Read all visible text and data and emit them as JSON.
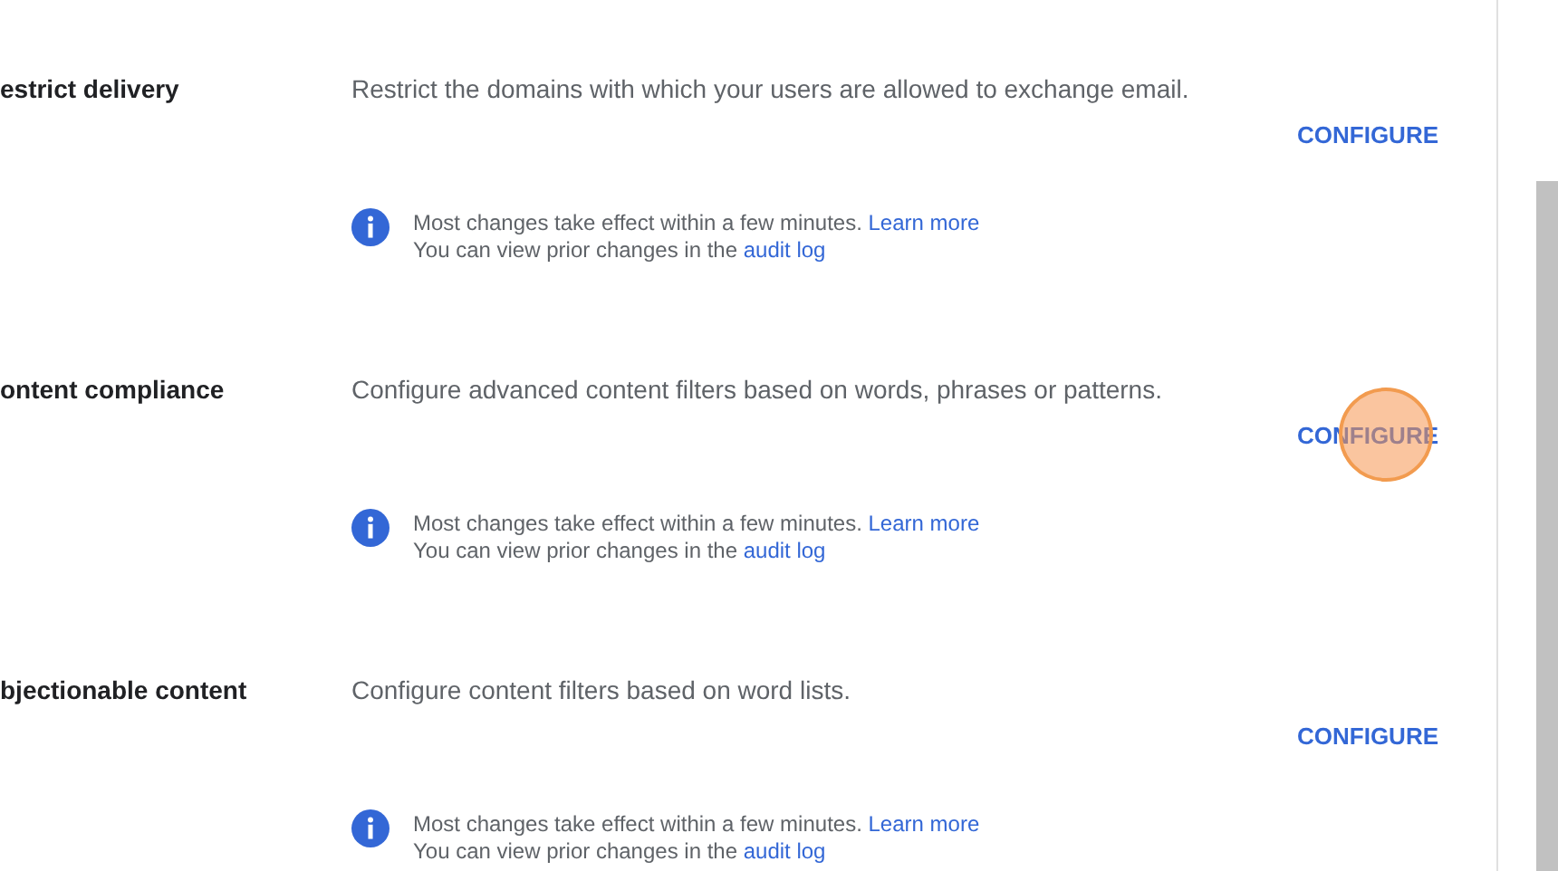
{
  "sections": [
    {
      "title": "estrict delivery",
      "description": "Restrict the domains with which your users are allowed to exchange email.",
      "action": "CONFIGURE",
      "click_highlight": false,
      "note": {
        "line1": "Most changes take effect within a few minutes.",
        "link1": "Learn more",
        "line2": "You can view prior changes in the",
        "link2": "audit log"
      }
    },
    {
      "title": "ontent compliance",
      "description": "Configure advanced content filters based on words, phrases or patterns.",
      "action": "CONFIGURE",
      "click_highlight": true,
      "note": {
        "line1": "Most changes take effect within a few minutes.",
        "link1": "Learn more",
        "line2": "You can view prior changes in the",
        "link2": "audit log"
      }
    },
    {
      "title": "bjectionable content",
      "description": "Configure content filters based on word lists.",
      "action": "CONFIGURE",
      "click_highlight": false,
      "note": {
        "line1": "Most changes take effect within a few minutes.",
        "link1": "Learn more",
        "line2": "You can view prior changes in the",
        "link2": "audit log"
      }
    }
  ]
}
